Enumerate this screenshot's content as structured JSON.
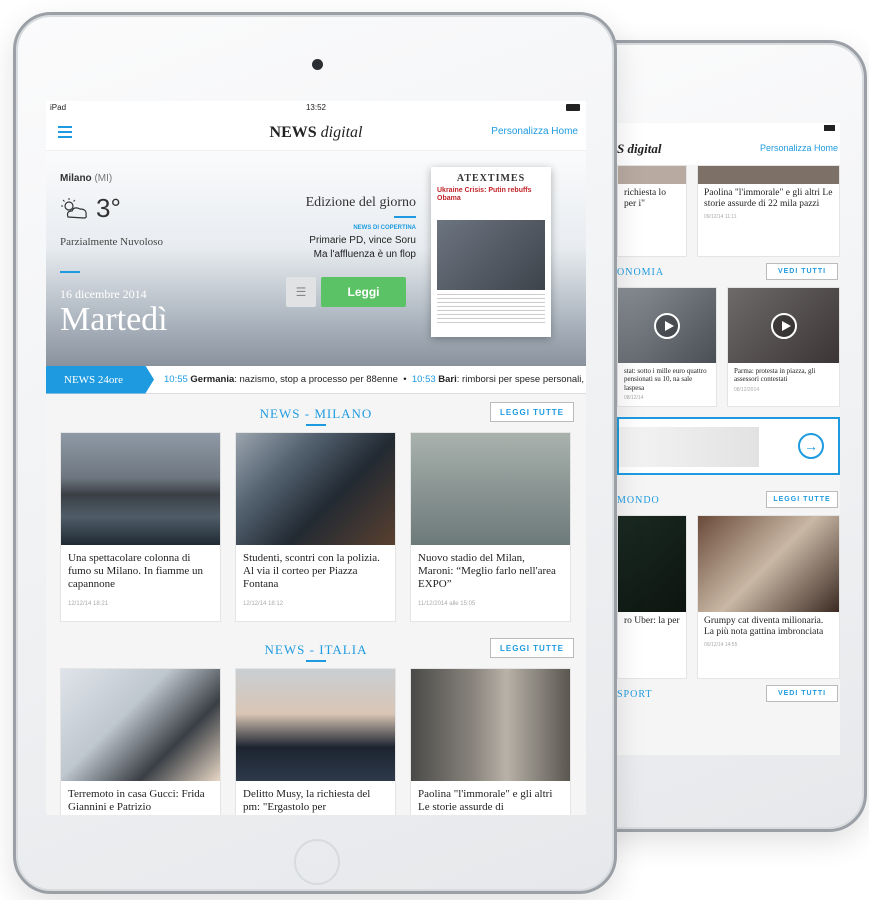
{
  "front": {
    "statusbar": {
      "device": "iPad",
      "time": "13:52"
    },
    "navbar": {
      "logo_bold": "NEWS",
      "logo_italic": "digital",
      "personalizza": "Personalizza Home"
    },
    "weather": {
      "city": "Milano",
      "province": "(MI)",
      "temperature": "3°",
      "condition": "Parzialmente Nuvoloso",
      "date": "16 dicembre 2014",
      "day": "Martedì"
    },
    "edition": {
      "title": "Edizione del giorno",
      "cover_label": "NEWS DI COPERTINA",
      "cover_line1": "Primarie PD, vince Soru",
      "cover_line2": "Ma l'affluenza è un flop",
      "read_button": "Leggi",
      "newspaper_title": "ATEXTIMES",
      "newspaper_headline": "Ukraine Crisis: Putin rebuffs Obama"
    },
    "ticker": {
      "label": "NEWS 24ore",
      "items": [
        {
          "time": "10:55",
          "place": "Germania",
          "text": ": nazismo, stop a processo per 88enne"
        },
        {
          "time": "10:53",
          "place": "Bari",
          "text": ": rimborsi per spese personali,"
        }
      ]
    },
    "sections": [
      {
        "title": "NEWS - MILANO",
        "button": "LEGGI TUTTE",
        "cards": [
          {
            "title": "Una spettacolare colonna di fumo su Milano. In fiamme un capannone",
            "meta": "12/12/14 18:21"
          },
          {
            "title": "Studenti, scontri con la polizia. Al via il corteo per Piazza Fontana",
            "meta": "12/12/14 18:12"
          },
          {
            "title": "Nuovo stadio del Milan, Maroni: “Meglio farlo nell'area EXPO”",
            "meta": "11/12/2014 alle 15:05"
          }
        ]
      },
      {
        "title": "NEWS - ITALIA",
        "button": "LEGGI TUTTE",
        "cards": [
          {
            "title": "Terremoto in casa Gucci: Frida Giannini e Patrizio"
          },
          {
            "title": "Delitto Musy, la richiesta del pm: \"Ergastolo per"
          },
          {
            "title": "Paolina \"l'immorale\" e gli altri Le storie assurde di"
          }
        ]
      }
    ]
  },
  "back": {
    "logo": "S digital",
    "personalizza": "Personalizza Home",
    "top_cards": [
      {
        "title": "richiesta lo per i\""
      },
      {
        "title": "Paolina \"l'immorale\" e gli altri Le storie assurde di 22 mila pazzi",
        "meta": "09/12/14 11:11"
      }
    ],
    "sections": [
      {
        "title": "ONOMIA",
        "button": "VEDI TUTTI"
      },
      {
        "title": "MONDO",
        "button": "LEGGI TUTTE"
      },
      {
        "title": "SPORT",
        "button": "VEDI TUTTI"
      }
    ],
    "video_cards": [
      {
        "title": "stat: sotto i mille euro quattro pensionati su 10, na sale laspesa",
        "meta": "08/12/14"
      },
      {
        "title": "Parma: protesta in piazza, gli assessori contestati",
        "meta": "08/12/2014"
      }
    ],
    "mondo_cards": [
      {
        "title": "ro Uber: la per"
      },
      {
        "title": "Grumpy cat diventa milionaria. La più nota gattina imbronciata",
        "meta": "09/12/14 14:55"
      }
    ]
  }
}
